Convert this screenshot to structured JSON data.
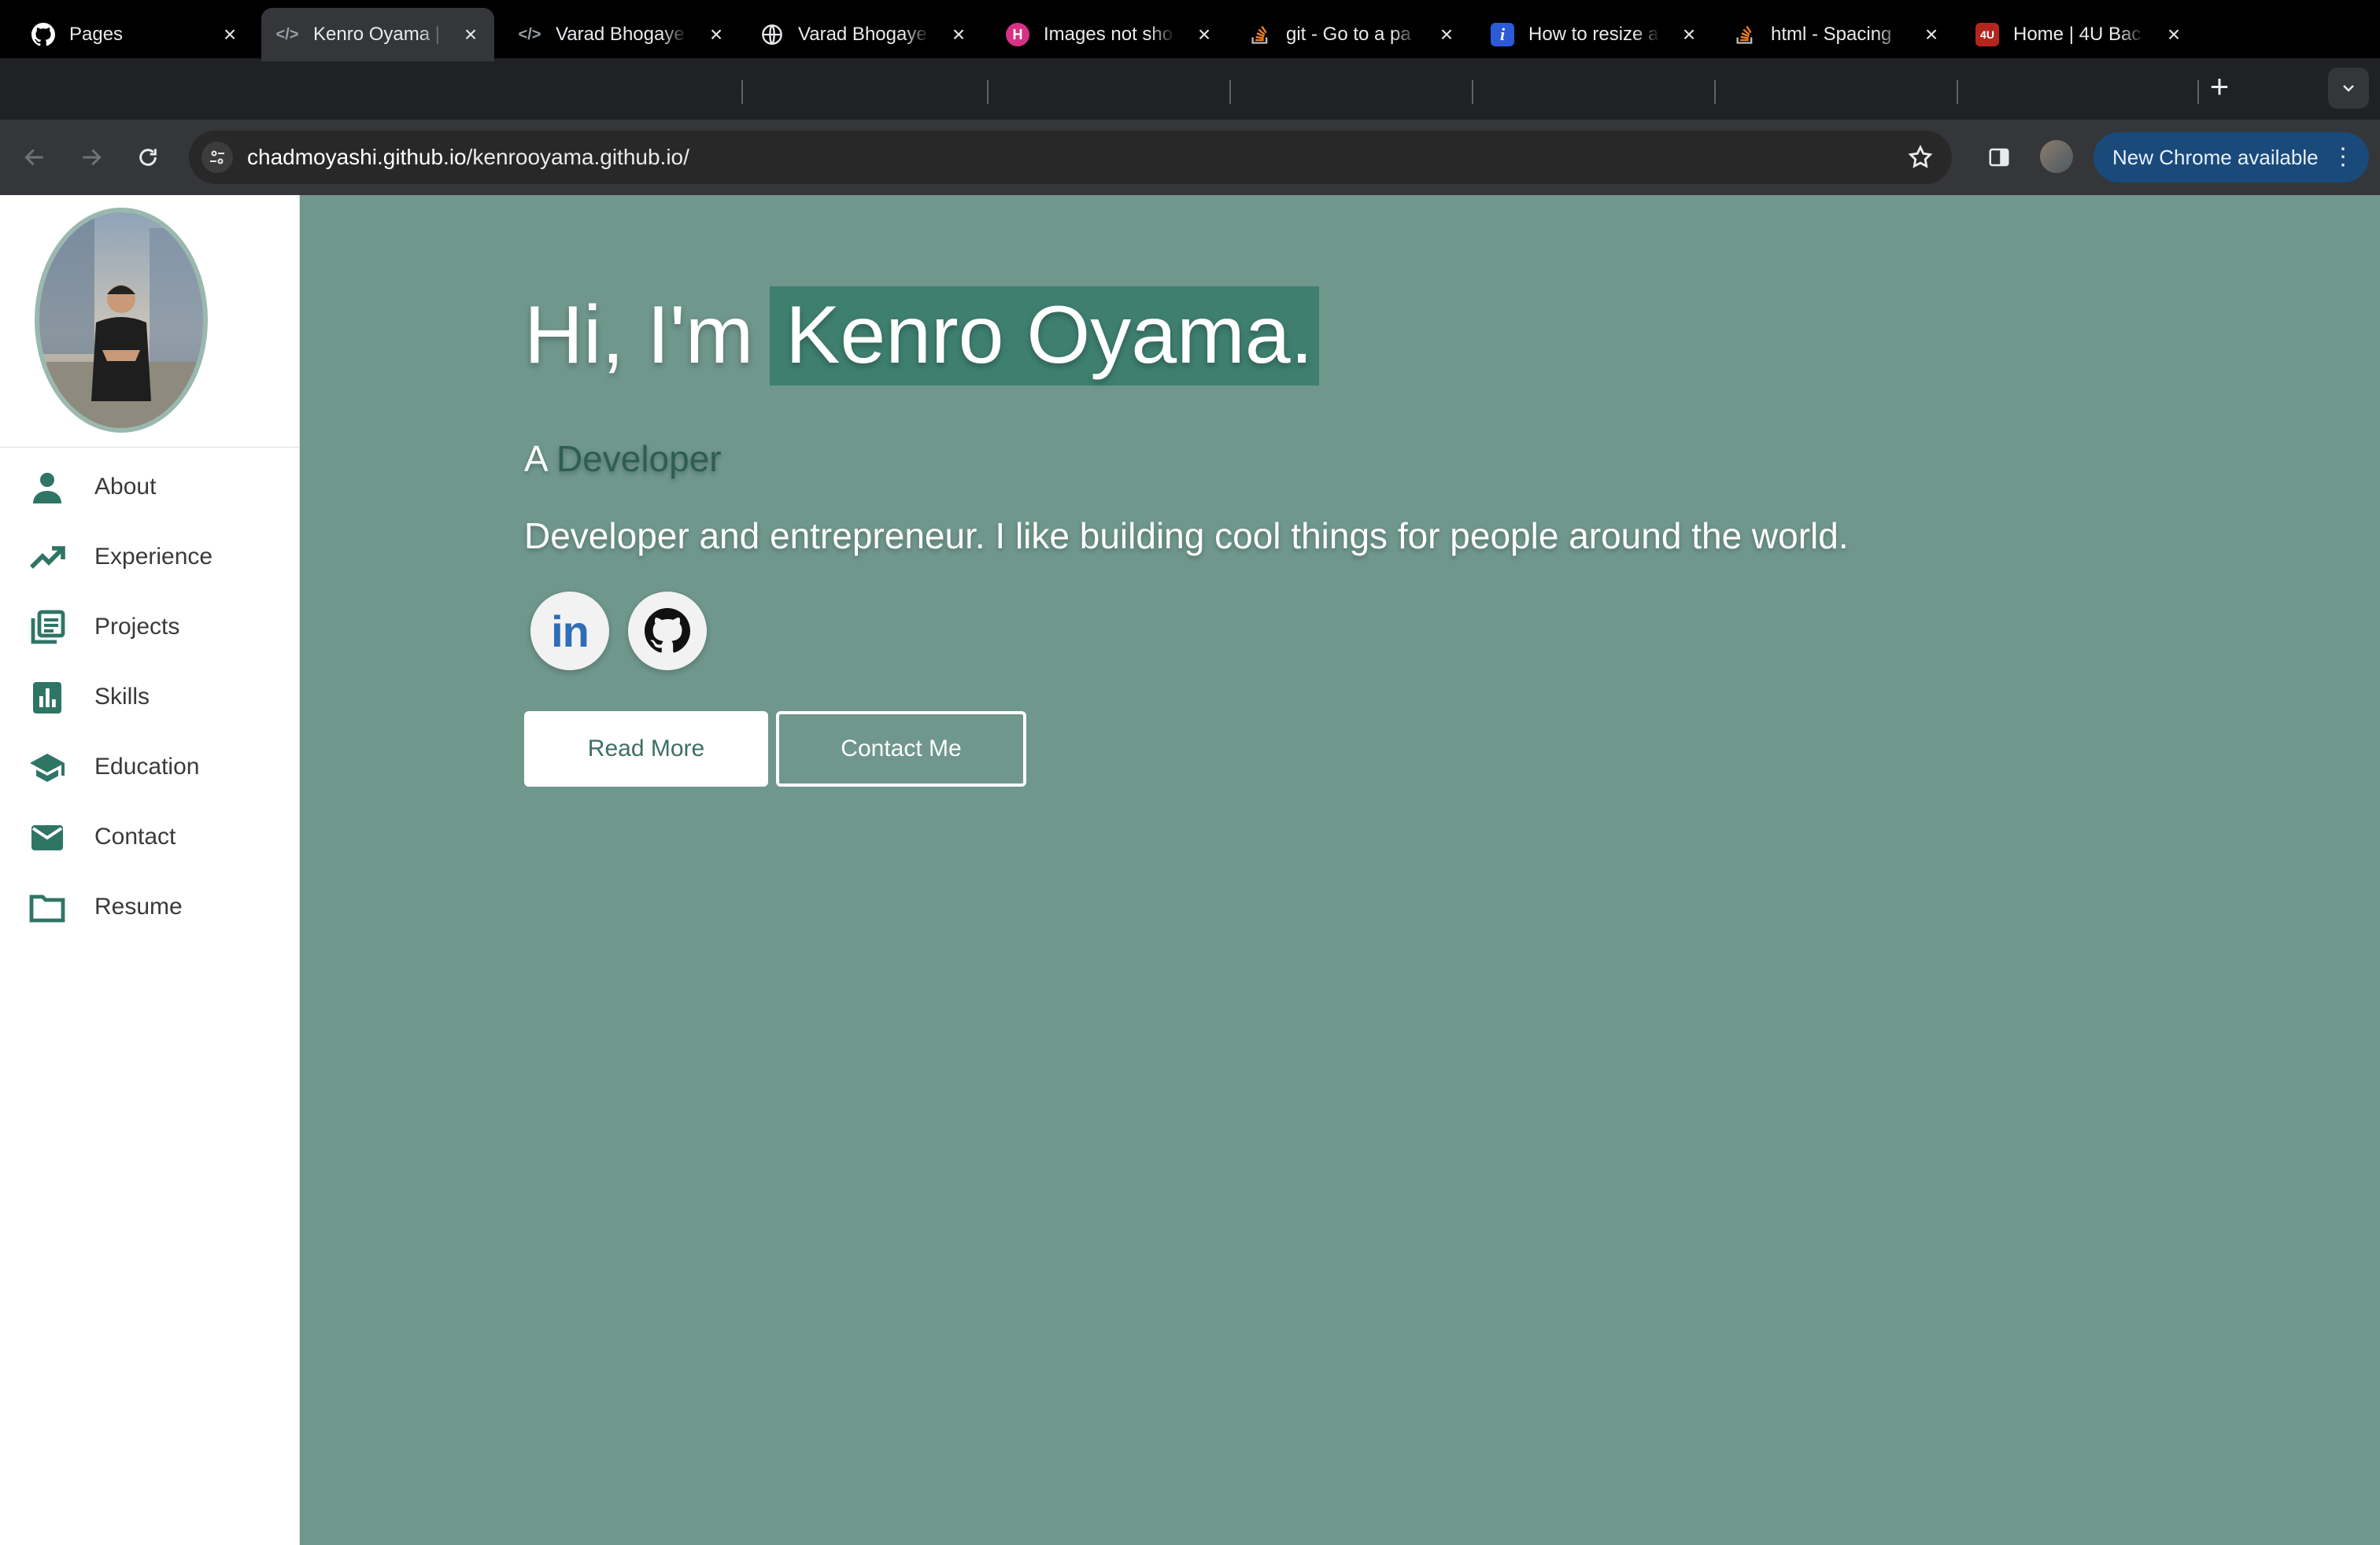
{
  "browser": {
    "tabs": [
      {
        "title": "Pages",
        "icon": "github-icon"
      },
      {
        "title": "Kenro Oyama |",
        "icon": "code-icon"
      },
      {
        "title": "Varad Bhogaye",
        "icon": "code-icon"
      },
      {
        "title": "Varad Bhogaye",
        "icon": "globe-icon"
      },
      {
        "title": "Images not sho",
        "icon": "hashnode-icon"
      },
      {
        "title": "git - Go to a pa",
        "icon": "stackoverflow-icon"
      },
      {
        "title": "How to resize a",
        "icon": "info-icon"
      },
      {
        "title": "html - Spacing",
        "icon": "stackoverflow-icon"
      },
      {
        "title": "Home | 4U Bac",
        "icon": "site-icon"
      }
    ],
    "url_domain": "chadmoyashi.github.io",
    "url_path": "/kenrooyama.github.io/",
    "update_button": "New Chrome available"
  },
  "sidebar": {
    "items": [
      {
        "label": "About",
        "icon": "person-icon"
      },
      {
        "label": "Experience",
        "icon": "trending-up-icon"
      },
      {
        "label": "Projects",
        "icon": "library-books-icon"
      },
      {
        "label": "Skills",
        "icon": "bar-chart-icon"
      },
      {
        "label": "Education",
        "icon": "school-icon"
      },
      {
        "label": "Contact",
        "icon": "mail-icon"
      },
      {
        "label": "Resume",
        "icon": "folder-icon"
      }
    ]
  },
  "hero": {
    "greeting": "Hi, I'm",
    "name": "Kenro Oyama.",
    "subtitle_prefix": "A",
    "subtitle_role": "Developer",
    "description": "Developer and entrepreneur. I like building cool things for people around the world.",
    "read_more": "Read More",
    "contact_me": "Contact Me"
  },
  "colors": {
    "page_bg": "#6f978c",
    "name_highlight": "#3e7f70",
    "accent": "#2f7566"
  }
}
